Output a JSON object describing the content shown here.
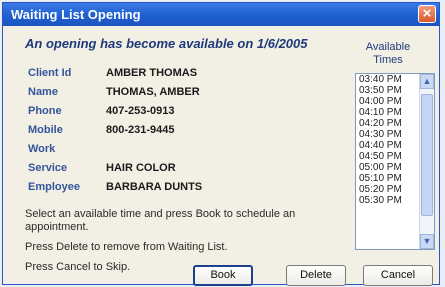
{
  "window": {
    "title": "Waiting List Opening",
    "close_glyph": "×"
  },
  "headline": "An opening has become available on 1/6/2005",
  "available_times_label": {
    "line1": "Available",
    "line2": "Times"
  },
  "fields": [
    {
      "label": "Client Id",
      "value": "AMBER THOMAS"
    },
    {
      "label": "Name",
      "value": "THOMAS, AMBER"
    },
    {
      "label": "Phone",
      "value": "407-253-0913"
    },
    {
      "label": "Mobile",
      "value": "800-231-9445"
    },
    {
      "label": "Work",
      "value": ""
    },
    {
      "label": "Service",
      "value": "HAIR COLOR"
    },
    {
      "label": "Employee",
      "value": "BARBARA DUNTS"
    }
  ],
  "instructions": {
    "book": "Select an available time and press Book to schedule an appointment.",
    "delete": "Press Delete to remove from Waiting List.",
    "cancel": "Press Cancel to Skip."
  },
  "times": [
    "03:40 PM",
    "03:50 PM",
    "04:00 PM",
    "04:10 PM",
    "04:20 PM",
    "04:30 PM",
    "04:40 PM",
    "04:50 PM",
    "05:00 PM",
    "05:10 PM",
    "05:20 PM",
    "05:30 PM"
  ],
  "buttons": {
    "book": "Book",
    "delete": "Delete",
    "cancel": "Cancel"
  },
  "icons": {
    "scroll_up": "scroll-up-arrow-icon",
    "scroll_down": "scroll-down-arrow-icon",
    "close": "close-icon"
  }
}
